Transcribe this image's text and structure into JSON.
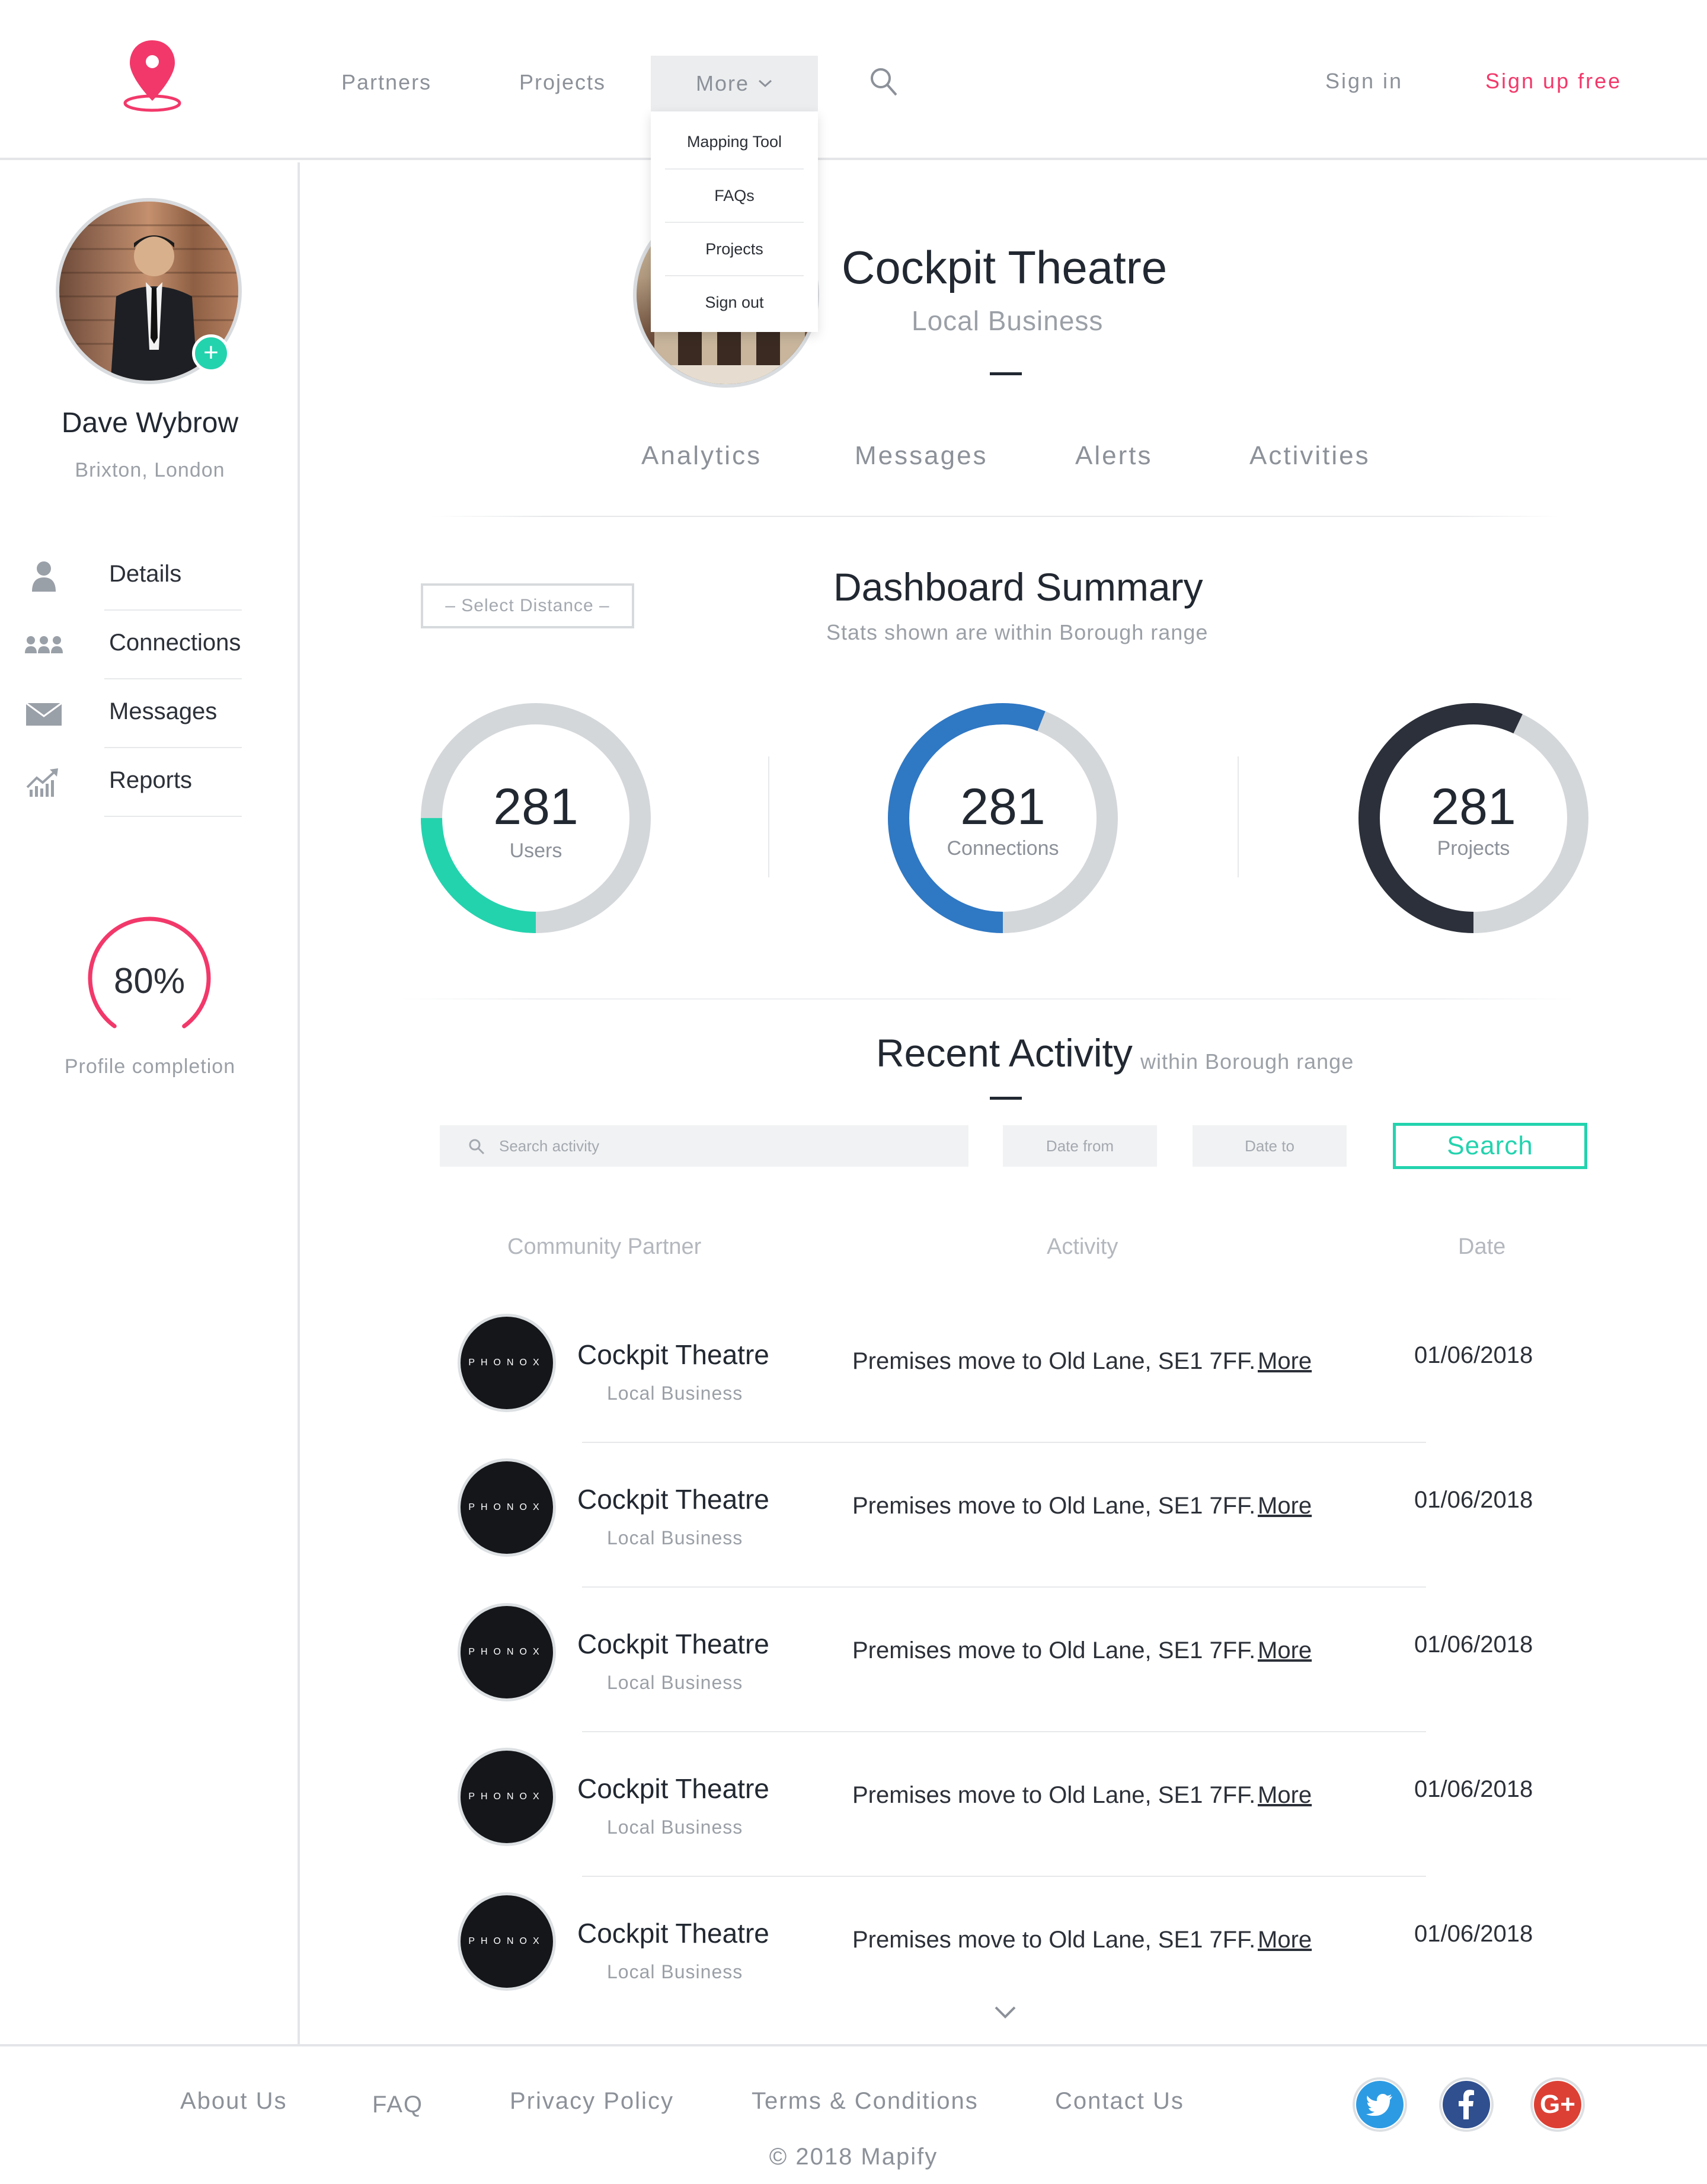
{
  "header": {
    "nav": {
      "partners": "Partners",
      "projects": "Projects",
      "more": "More"
    },
    "sign_in": "Sign in",
    "sign_up": "Sign up free",
    "dropdown": [
      "Mapping Tool",
      "FAQs",
      "Projects",
      "Sign out"
    ]
  },
  "colors": {
    "accent_pink": "#f2386a",
    "accent_teal": "#23d3ae",
    "accent_blue": "#2f78c4",
    "dark": "#2b303a",
    "ring_track": "#d4d7da"
  },
  "sidebar": {
    "user_name": "Dave Wybrow",
    "user_location": "Brixton, London",
    "items": [
      {
        "label": "Details",
        "icon": "user-icon"
      },
      {
        "label": "Connections",
        "icon": "group-icon"
      },
      {
        "label": "Messages",
        "icon": "envelope-icon"
      },
      {
        "label": "Reports",
        "icon": "chart-trend-icon"
      }
    ],
    "profile_completion": {
      "value": "80%",
      "fraction": 0.8,
      "label": "Profile completion"
    }
  },
  "profile": {
    "title": "Cockpit Theatre",
    "subtitle": "Local Business",
    "tabs": [
      "Analytics",
      "Messages",
      "Alerts",
      "Activities"
    ]
  },
  "dashboard": {
    "select_distance": "– Select Distance –",
    "title": "Dashboard Summary",
    "subtitle": "Stats shown are within Borough range",
    "stats": [
      {
        "value": "281",
        "label": "Users",
        "fraction": 0.25,
        "color": "#23d3ae"
      },
      {
        "value": "281",
        "label": "Connections",
        "fraction": 0.56,
        "color": "#2f78c4"
      },
      {
        "value": "281",
        "label": "Projects",
        "fraction": 0.57,
        "color": "#2b303a"
      }
    ]
  },
  "recent_activity": {
    "title": "Recent Activity",
    "subtitle": "within Borough range",
    "search_placeholder": "Search activity",
    "date_from": "Date from",
    "date_to": "Date to",
    "search_button": "Search",
    "columns": [
      "Community Partner",
      "Activity",
      "Date"
    ],
    "rows": [
      {
        "logo": "PHONOX",
        "name": "Cockpit Theatre",
        "type": "Local Business",
        "activity": "Premises move to Old Lane, SE1 7FF.",
        "more": "More",
        "date": "01/06/2018"
      },
      {
        "logo": "PHONOX",
        "name": "Cockpit Theatre",
        "type": "Local Business",
        "activity": "Premises move to Old Lane, SE1 7FF.",
        "more": "More",
        "date": "01/06/2018"
      },
      {
        "logo": "PHONOX",
        "name": "Cockpit Theatre",
        "type": "Local Business",
        "activity": "Premises move to Old Lane, SE1 7FF.",
        "more": "More",
        "date": "01/06/2018"
      },
      {
        "logo": "PHONOX",
        "name": "Cockpit Theatre",
        "type": "Local Business",
        "activity": "Premises move to Old Lane, SE1 7FF.",
        "more": "More",
        "date": "01/06/2018"
      },
      {
        "logo": "PHONOX",
        "name": "Cockpit Theatre",
        "type": "Local Business",
        "activity": "Premises move to Old Lane, SE1 7FF.",
        "more": "More",
        "date": "01/06/2018"
      }
    ]
  },
  "footer": {
    "links": [
      "About Us",
      "FAQ",
      "Privacy Policy",
      "Terms & Conditions",
      "Contact Us"
    ],
    "social": [
      {
        "name": "twitter-icon",
        "color": "#2d9be3"
      },
      {
        "name": "facebook-icon",
        "color": "#2f4f8f"
      },
      {
        "name": "google-plus-icon",
        "color": "#dc4034",
        "glyph": "G+"
      }
    ],
    "copyright": "© 2018 Mapify"
  }
}
